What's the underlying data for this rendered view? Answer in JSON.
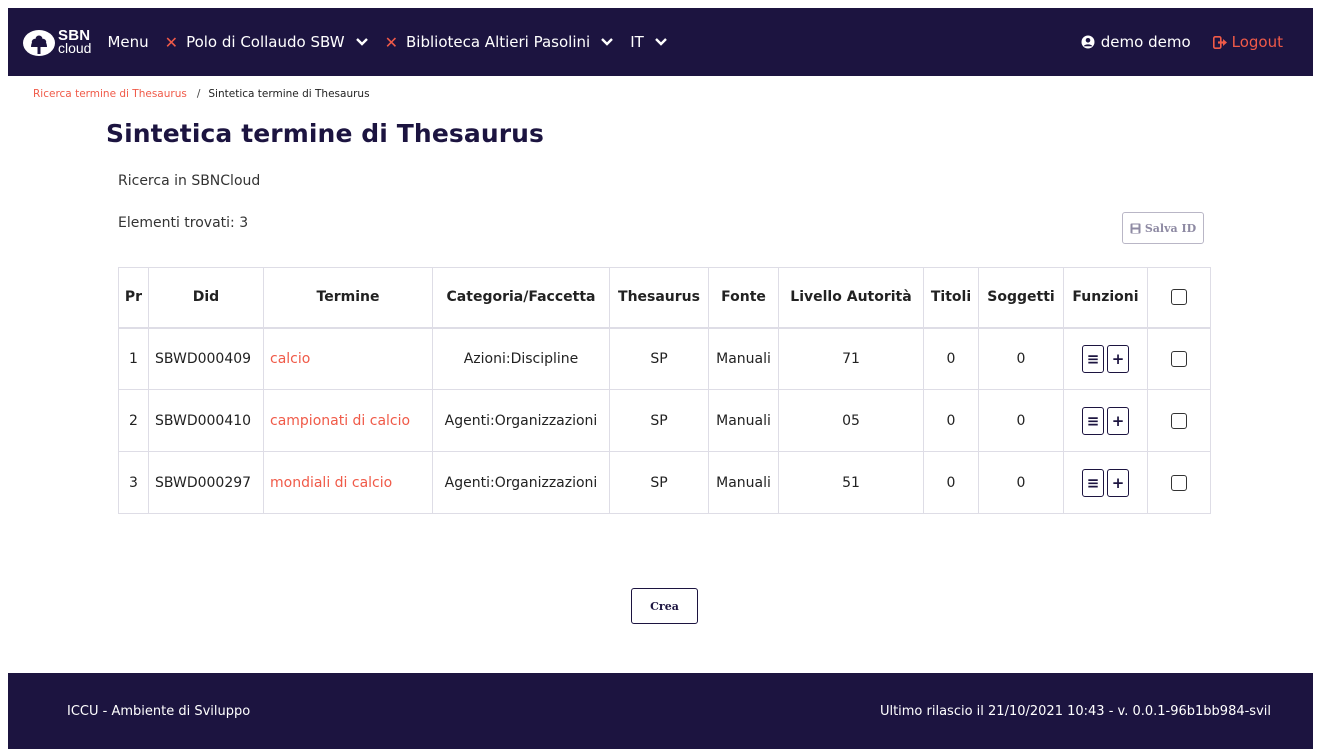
{
  "header": {
    "logo_line1": "SBN",
    "logo_line2": "cloud",
    "menu_label": "Menu",
    "polo_label": "Polo di Collaudo SBW",
    "biblioteca_label": "Biblioteca Altieri Pasolini",
    "language_label": "IT",
    "user_label": "demo demo",
    "logout_label": "Logout",
    "accent_color": "#f05a48",
    "bg_color": "#1c1440"
  },
  "breadcrumb": {
    "parent": "Ricerca termine di Thesaurus",
    "separator": "/",
    "current": "Sintetica termine di Thesaurus"
  },
  "page": {
    "title": "Sintetica termine di Thesaurus",
    "subtitle": "Ricerca in SBNCloud",
    "found_label": "Elementi trovati: 3",
    "save_id_label": "Salva ID",
    "create_label": "Crea"
  },
  "table": {
    "headers": [
      "Pr",
      "Did",
      "Termine",
      "Categoria/Faccetta",
      "Thesaurus",
      "Fonte",
      "Livello Autorità",
      "Titoli",
      "Soggetti",
      "Funzioni"
    ],
    "rows": [
      {
        "pr": "1",
        "did": "SBWD000409",
        "termine": "calcio",
        "categoria": "Azioni:Discipline",
        "thesaurus": "SP",
        "fonte": "Manuali",
        "livello": "71",
        "titoli": "0",
        "soggetti": "0"
      },
      {
        "pr": "2",
        "did": "SBWD000410",
        "termine": "campionati di calcio",
        "categoria": "Agenti:Organizzazioni",
        "thesaurus": "SP",
        "fonte": "Manuali",
        "livello": "05",
        "titoli": "0",
        "soggetti": "0"
      },
      {
        "pr": "3",
        "did": "SBWD000297",
        "termine": "mondiali di calcio",
        "categoria": "Agenti:Organizzazioni",
        "thesaurus": "SP",
        "fonte": "Manuali",
        "livello": "51",
        "titoli": "0",
        "soggetti": "0"
      }
    ],
    "function_icons": [
      "list-icon",
      "plus-icon"
    ]
  },
  "footer": {
    "left": "ICCU - Ambiente di Sviluppo",
    "right": "Ultimo rilascio il 21/10/2021 10:43 - v. 0.0.1-96b1bb984-svil"
  }
}
